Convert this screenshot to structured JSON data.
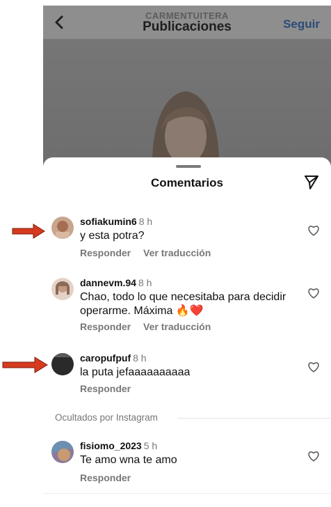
{
  "header": {
    "account": "CARMENTUITERA",
    "title": "Publicaciones",
    "follow_label": "Seguir"
  },
  "sheet": {
    "title": "Comentarios"
  },
  "comments": [
    {
      "username": "sofiakumin6",
      "time": "8 h",
      "text": "y esta potra?",
      "reply_label": "Responder",
      "translate_label": "Ver traducción"
    },
    {
      "username": "dannevm.94",
      "time": "8 h",
      "text": "Chao, todo lo que necesitaba para decidir operarme. Máxima 🔥❤️",
      "reply_label": "Responder",
      "translate_label": "Ver traducción"
    },
    {
      "username": "caropufpuf",
      "time": "8 h",
      "text": "la puta jefaaaaaaaaaa",
      "reply_label": "Responder"
    }
  ],
  "hidden_section": {
    "label": "Ocultados por Instagram",
    "comments": [
      {
        "username": "fisiomo_2023",
        "time": "5 h",
        "text": "Te amo wna te amo",
        "reply_label": "Responder"
      }
    ]
  },
  "annotation": {
    "arrow_color": "#d63a1f"
  }
}
